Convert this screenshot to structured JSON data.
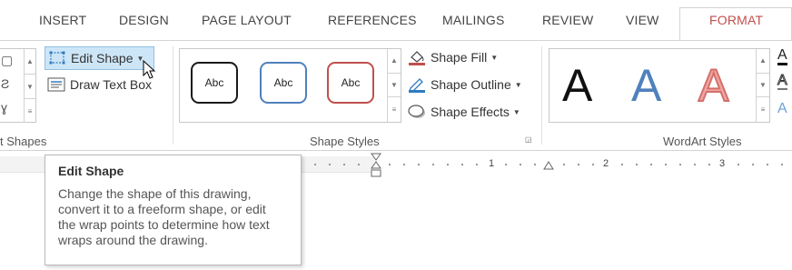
{
  "tabs": [
    {
      "label": "INSERT",
      "active": false
    },
    {
      "label": "DESIGN",
      "active": false
    },
    {
      "label": "PAGE LAYOUT",
      "active": false
    },
    {
      "label": "REFERENCES",
      "active": false
    },
    {
      "label": "MAILINGS",
      "active": false
    },
    {
      "label": "REVIEW",
      "active": false
    },
    {
      "label": "VIEW",
      "active": false
    },
    {
      "label": "FORMAT",
      "active": true
    }
  ],
  "insert_shapes": {
    "group_label": "t Shapes",
    "edit_shape_label": "Edit Shape",
    "draw_text_box_label": "Draw Text Box"
  },
  "shape_styles": {
    "group_label": "Shape Styles",
    "thumbnails": [
      "Abc",
      "Abc",
      "Abc"
    ],
    "shape_fill_label": "Shape Fill",
    "shape_outline_label": "Shape Outline",
    "shape_effects_label": "Shape Effects"
  },
  "wordart_styles": {
    "group_label": "WordArt Styles",
    "samples": [
      "A",
      "A",
      "A"
    ]
  },
  "ruler": {
    "numbers": [
      "1",
      "2",
      "3"
    ]
  },
  "tooltip": {
    "title": "Edit Shape",
    "body": "Change the shape of this drawing, convert it to a freeform shape, or edit the wrap points to determine how text wraps around the drawing."
  },
  "colors": {
    "accent": "#c0504d",
    "hover_fill": "#cde6f7",
    "blue": "#4f81bd",
    "red": "#c0504d"
  }
}
